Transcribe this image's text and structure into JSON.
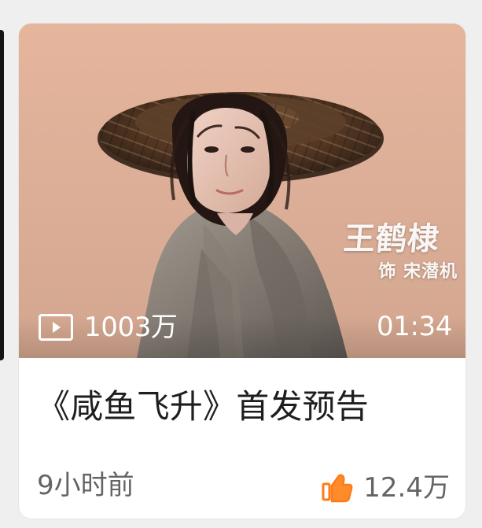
{
  "card": {
    "title": "《咸鱼飞升》首发预告",
    "time_ago": "9小时前",
    "like_count": "12.4万",
    "play_count": "1003万",
    "duration": "01:34",
    "actor_name": "王鹤棣",
    "role_text": "饰 宋潜机"
  },
  "icons": {
    "play": "play-icon",
    "like": "thumbs-up-icon"
  },
  "colors": {
    "background": "#efefef",
    "card": "#ffffff",
    "title": "#1e1e1e",
    "meta": "#646464",
    "like_accent": "#ff7a1a"
  }
}
